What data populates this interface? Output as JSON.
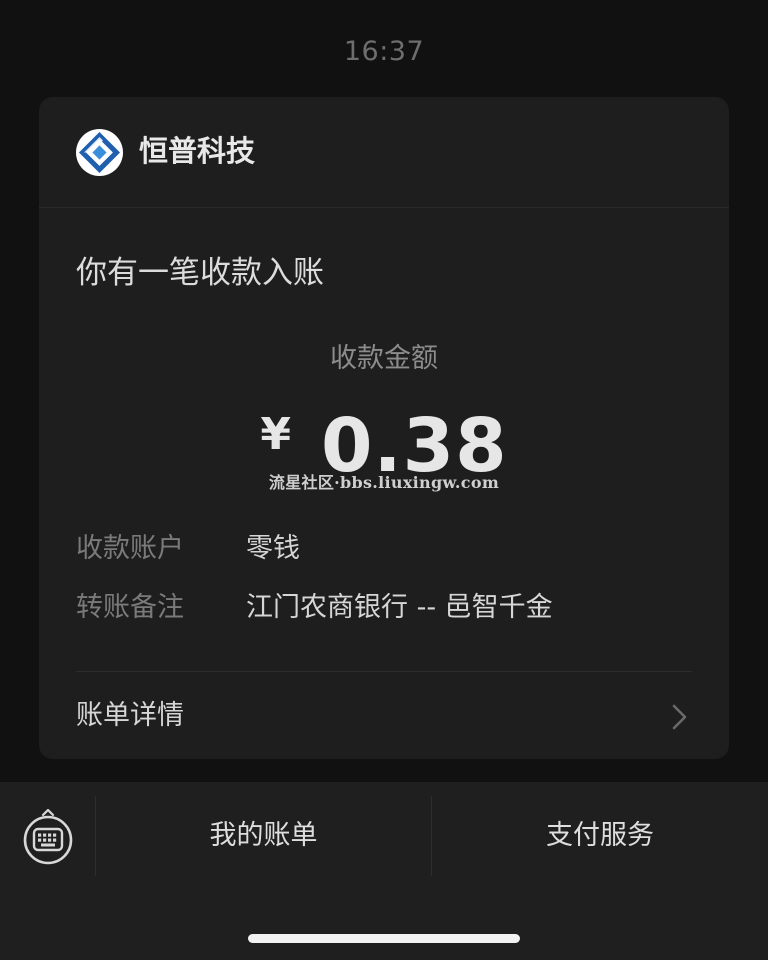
{
  "status_bar": {
    "time": "16:37"
  },
  "card": {
    "merchant_name": "恒普科技",
    "logo_icon": "merchant-logo-icon",
    "notice_title": "你有一笔收款入账",
    "amount_label": "收款金额",
    "currency_symbol": "¥",
    "amount": "0.38",
    "watermark": "流星社区·bbs.liuxingw.com",
    "info_rows": [
      {
        "key": "收款账户",
        "value": "零钱"
      },
      {
        "key": "转账备注",
        "value": "江门农商银行 -- 邑智千金"
      }
    ],
    "detail_link": "账单详情",
    "detail_icon": "chevron-right-icon"
  },
  "bottom_menu": {
    "keyboard_icon": "keyboard-icon",
    "items": [
      {
        "label": "我的账单"
      },
      {
        "label": "支付服务"
      }
    ]
  },
  "colors": {
    "background": "#111111",
    "card": "#1e1e1e",
    "bottom_bar": "#1f1f1f",
    "logo_blue": "#1f5fae"
  }
}
